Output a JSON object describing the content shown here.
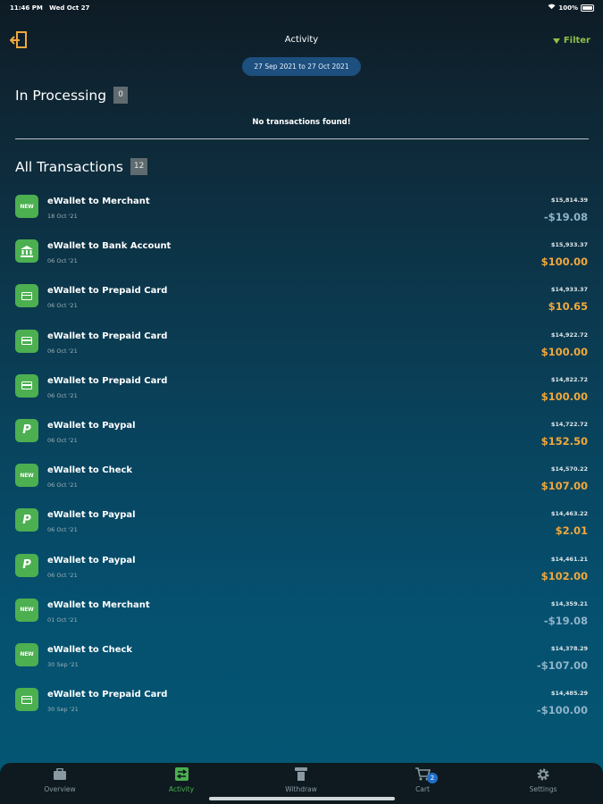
{
  "status_bar": {
    "time": "11:46 PM",
    "date": "Wed Oct 27",
    "battery": "100%"
  },
  "header": {
    "title": "Activity",
    "filter_label": "Filter"
  },
  "date_range": "27 Sep 2021 to 27 Oct 2021",
  "processing": {
    "title": "In Processing",
    "count": "0",
    "empty_message": "No transactions found!"
  },
  "all_transactions": {
    "title": "All Transactions",
    "count": "12",
    "items": [
      {
        "icon": "new-icon",
        "name": "eWallet to Merchant",
        "date": "18 Oct '21",
        "balance": "$15,814.39",
        "amount": "-$19.08",
        "kind": "negative"
      },
      {
        "icon": "bank-icon",
        "name": "eWallet to Bank Account",
        "date": "06 Oct '21",
        "balance": "$15,933.37",
        "amount": "$100.00",
        "kind": "positive"
      },
      {
        "icon": "card-icon",
        "name": "eWallet to Prepaid Card",
        "date": "06 Oct '21",
        "balance": "$14,933.37",
        "amount": "$10.65",
        "kind": "positive"
      },
      {
        "icon": "card-icon",
        "name": "eWallet to Prepaid Card",
        "date": "06 Oct '21",
        "balance": "$14,922.72",
        "amount": "$100.00",
        "kind": "positive"
      },
      {
        "icon": "card-icon",
        "name": "eWallet to Prepaid Card",
        "date": "06 Oct '21",
        "balance": "$14,822.72",
        "amount": "$100.00",
        "kind": "positive"
      },
      {
        "icon": "paypal-icon",
        "name": "eWallet to Paypal",
        "date": "06 Oct '21",
        "balance": "$14,722.72",
        "amount": "$152.50",
        "kind": "positive"
      },
      {
        "icon": "new-icon",
        "name": "eWallet to Check",
        "date": "06 Oct '21",
        "balance": "$14,570.22",
        "amount": "$107.00",
        "kind": "positive"
      },
      {
        "icon": "paypal-icon",
        "name": "eWallet to Paypal",
        "date": "06 Oct '21",
        "balance": "$14,463.22",
        "amount": "$2.01",
        "kind": "positive"
      },
      {
        "icon": "paypal-icon",
        "name": "eWallet to Paypal",
        "date": "06 Oct '21",
        "balance": "$14,461.21",
        "amount": "$102.00",
        "kind": "positive"
      },
      {
        "icon": "new-icon",
        "name": "eWallet to Merchant",
        "date": "01 Oct '21",
        "balance": "$14,359.21",
        "amount": "-$19.08",
        "kind": "negative"
      },
      {
        "icon": "new-icon",
        "name": "eWallet to Check",
        "date": "30 Sep '21",
        "balance": "$14,378.29",
        "amount": "-$107.00",
        "kind": "negative"
      },
      {
        "icon": "card-icon",
        "name": "eWallet to Prepaid Card",
        "date": "30 Sep '21",
        "balance": "$14,485.29",
        "amount": "-$100.00",
        "kind": "negative"
      }
    ]
  },
  "bottom_nav": [
    {
      "label": "Overview",
      "icon": "briefcase-icon",
      "active": false
    },
    {
      "label": "Activity",
      "icon": "activity-icon",
      "active": true
    },
    {
      "label": "Withdraw",
      "icon": "withdraw-icon",
      "active": false
    },
    {
      "label": "Cart",
      "icon": "cart-icon",
      "active": false,
      "badge": "2"
    },
    {
      "label": "Settings",
      "icon": "gear-icon",
      "active": false
    }
  ],
  "colors": {
    "accent_green": "#4caf50",
    "positive_amount": "#f0a83c",
    "negative_amount": "#8fb3c9",
    "filter": "#8fbf4a"
  }
}
